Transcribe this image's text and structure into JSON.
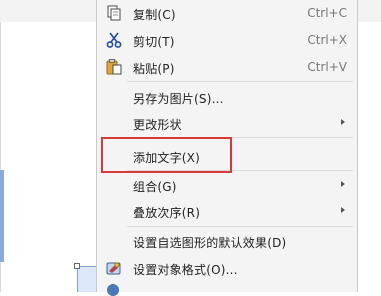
{
  "menu": {
    "items": [
      {
        "label": "复制(C)",
        "shortcut": "Ctrl+C",
        "icon": "copy-icon"
      },
      {
        "label": "剪切(T)",
        "shortcut": "Ctrl+X",
        "icon": "scissors-icon"
      },
      {
        "label": "粘贴(P)",
        "shortcut": "Ctrl+V",
        "icon": "paste-icon"
      },
      {
        "label": "另存为图片(S)..."
      },
      {
        "label": "更改形状"
      },
      {
        "label": "添加文字(X)"
      },
      {
        "label": "组合(G)"
      },
      {
        "label": "叠放次序(R)"
      },
      {
        "label": "设置自选图形的默认效果(D)"
      },
      {
        "label": "设置对象格式(O)...",
        "icon": "format-object-icon"
      }
    ]
  },
  "colors": {
    "highlight": "#d9383a",
    "menu_background": "#f4f4f4",
    "selection_shape_fill": "#dce8f7"
  }
}
